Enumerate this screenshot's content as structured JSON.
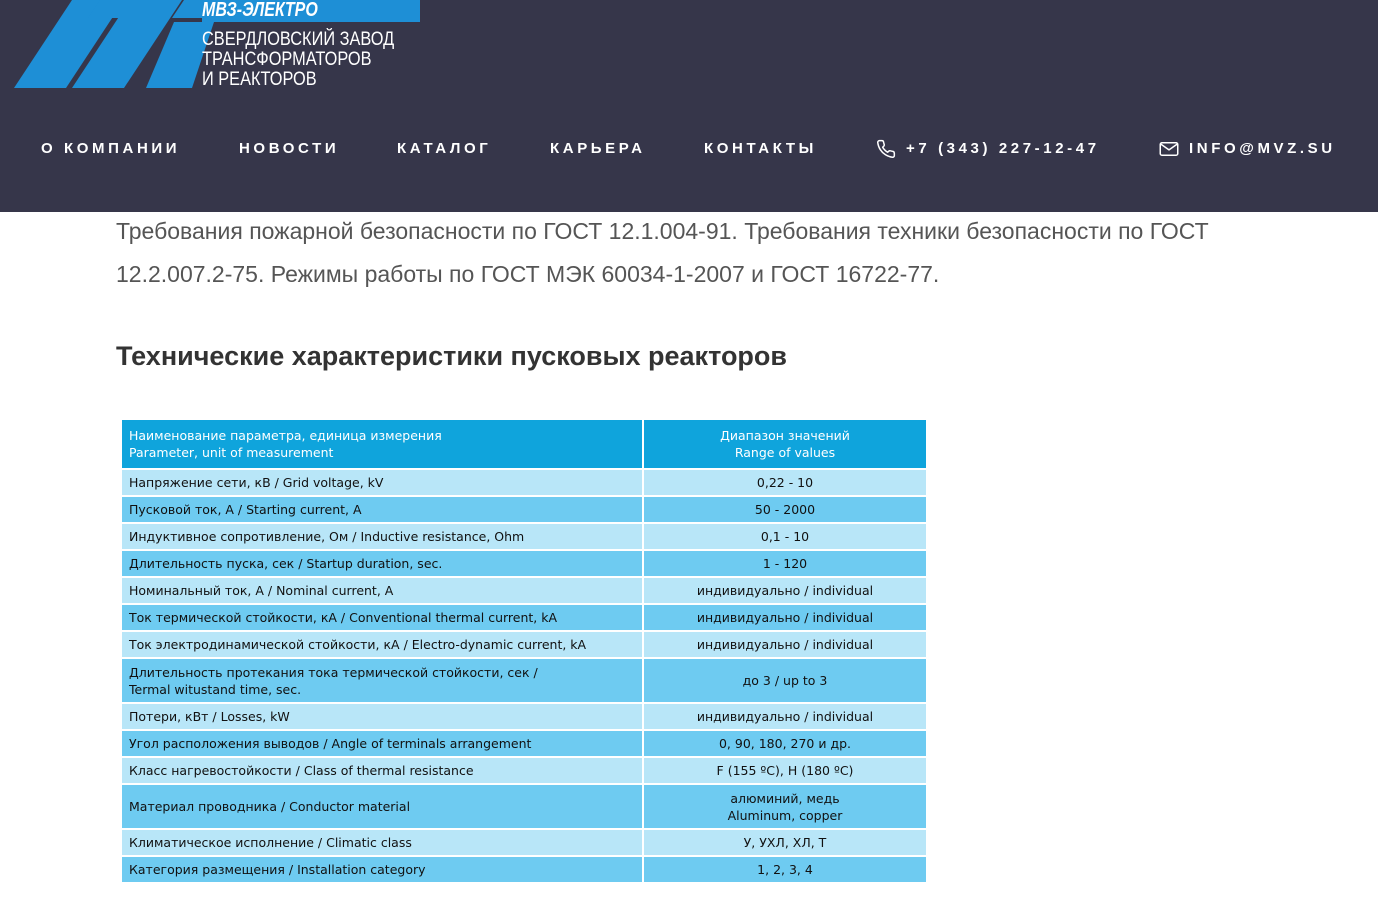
{
  "header": {
    "brand": "МВЗ-ЭЛЕКТРО",
    "company_lines": [
      "СВЕРДЛОВСКИЙ ЗАВОД",
      "ТРАНСФОРМАТОРОВ",
      "И РЕАКТОРОВ"
    ],
    "bg_color": "#36364a",
    "logo_color": "#1e8fd6"
  },
  "nav": {
    "about": "О КОМПАНИИ",
    "news": "НОВОСТИ",
    "catalog": "КАТАЛОГ",
    "career": "КАРЬЕРА",
    "contacts": "КОНТАКТЫ",
    "phone": "+7 (343) 227-12-47",
    "phone_icon": "phone-icon",
    "email": "INFO@MVZ.SU",
    "email_icon": "mail-icon"
  },
  "content": {
    "intro_line1": "Требования пожарной безопасности по ГОСТ 12.1.004-91. Требования техники безопасности по ГОСТ",
    "intro_line2": "12.2.007.2-75. Режимы работы по ГОСТ МЭК 60034-1-2007 и ГОСТ 16722-77.",
    "section_title": "Технические характеристики пусковых реакторов"
  },
  "table": {
    "header": {
      "param_ru": "Наименование параметра, единица измерения",
      "param_en": "Parameter, unit of measurement",
      "range_ru": "Диапазон значений",
      "range_en": "Range of values"
    },
    "rows": [
      {
        "param": "Напряжение сети, кВ / Grid voltage, kV",
        "value": "0,22 - 10"
      },
      {
        "param": "Пусковой ток, А / Starting current, A",
        "value": "50 - 2000"
      },
      {
        "param": "Индуктивное сопротивление, Ом / Inductive resistance, Ohm",
        "value": "0,1 - 10"
      },
      {
        "param": "Длительность пуска, сек / Startup duration, sec.",
        "value": "1 - 120"
      },
      {
        "param": "Номинальный ток, А / Nominal current, A",
        "value": "индивидуально / individual"
      },
      {
        "param": "Ток термической стойкости, кА / Conventional thermal current, kA",
        "value": "индивидуально / individual"
      },
      {
        "param": "Ток электродинамической стойкости, кА / Electro-dynamic current, kA",
        "value": "индивидуально / individual"
      },
      {
        "param_line1": "Длительность протекания тока термической стойкости, сек /",
        "param_line2": "Termal witustand time, sec.",
        "value": "до 3 / up to 3"
      },
      {
        "param": "Потери, кВт / Losses, kW",
        "value": "индивидуально / individual"
      },
      {
        "param": "Угол расположения выводов / Angle of terminals arrangement",
        "value": "0, 90, 180, 270 и др."
      },
      {
        "param": "Класс нагревостойкости / Class of thermal resistance",
        "value": "F (155 ºC), H (180 ºC)"
      },
      {
        "param": "Материал проводника / Conductor material",
        "value_line1": "алюминий, медь",
        "value_line2": "Aluminum, copper"
      },
      {
        "param": "Климатическое исполнение / Climatic class",
        "value": "У, УХЛ, ХЛ, Т"
      },
      {
        "param": "Категория размещения / Installation category",
        "value": "1, 2, 3, 4"
      }
    ],
    "colors": {
      "header": "#0fa4dc",
      "light": "#b8e6f8",
      "mid": "#6ecbf1"
    }
  }
}
